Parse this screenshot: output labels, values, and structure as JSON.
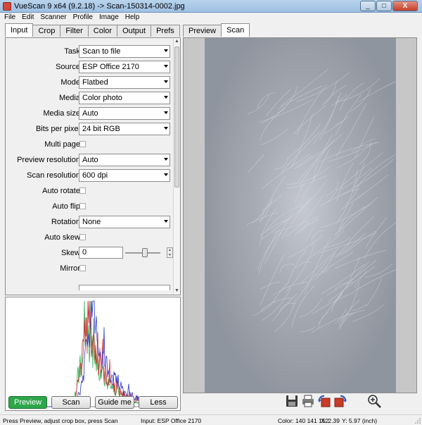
{
  "window": {
    "title": "VueScan 9 x64 (9.2.18) -> Scan-150314-0002.jpg",
    "min_label": "_",
    "max_label": "□",
    "close_label": "X"
  },
  "menu": [
    "File",
    "Edit",
    "Scanner",
    "Profile",
    "Image",
    "Help"
  ],
  "left_tabs": [
    "Input",
    "Crop",
    "Filter",
    "Color",
    "Output",
    "Prefs"
  ],
  "active_left_tab": "Input",
  "input_fields": [
    {
      "label": "Task:",
      "type": "select",
      "value": "Scan to file"
    },
    {
      "label": "Source:",
      "type": "select",
      "value": "ESP Office 2170"
    },
    {
      "label": "Mode:",
      "type": "select",
      "value": "Flatbed"
    },
    {
      "label": "Media:",
      "type": "select",
      "value": "Color photo"
    },
    {
      "label": "Media size:",
      "type": "select",
      "value": "Auto"
    },
    {
      "label": "Bits per pixel:",
      "type": "select",
      "value": "24 bit RGB"
    },
    {
      "label": "Multi page:",
      "type": "checkbox",
      "value": ""
    },
    {
      "label": "Preview resolution:",
      "type": "select",
      "value": "Auto"
    },
    {
      "label": "Scan resolution:",
      "type": "select",
      "value": "600 dpi"
    },
    {
      "label": "Auto rotate:",
      "type": "checkbox",
      "value": ""
    },
    {
      "label": "Auto flip:",
      "type": "checkbox",
      "value": ""
    },
    {
      "label": "Rotation:",
      "type": "select",
      "value": "None"
    },
    {
      "label": "Auto skew:",
      "type": "checkbox",
      "value": ""
    },
    {
      "label": "Skew:",
      "type": "text",
      "value": "0"
    },
    {
      "label": "Mirror:",
      "type": "checkbox",
      "value": ""
    }
  ],
  "right_tabs": [
    "Preview",
    "Scan"
  ],
  "active_right_tab": "Scan",
  "buttons": {
    "preview": "Preview",
    "scan": "Scan",
    "guide": "Guide me",
    "less": "Less"
  },
  "toolbar_icons": [
    "save-icon",
    "print-icon",
    "rotate-left-icon",
    "rotate-right-icon"
  ],
  "zoom_icon": "zoom-in-icon",
  "status": {
    "hint": "Press Preview, adjust crop box, press Scan",
    "input": "Input: ESP Office 2170",
    "color": "Color: 140 141 152",
    "x": "X: 2.39",
    "y": "Y: 5.97 (inch)"
  },
  "colors": {
    "preview_button": "#2ea64a",
    "scan_background": "#8f959e",
    "hist_red": "#d8262a",
    "hist_green": "#2ca84a",
    "hist_blue": "#2a36c8"
  }
}
